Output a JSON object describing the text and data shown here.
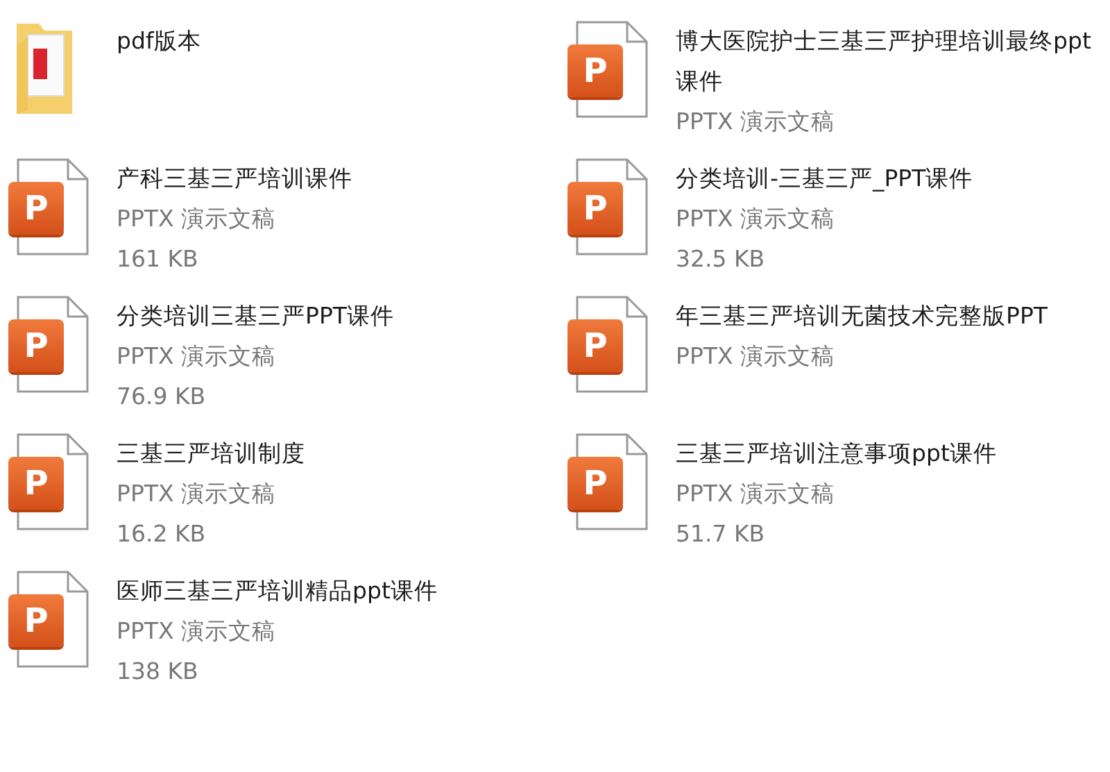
{
  "items": [
    {
      "kind": "folder",
      "name": "pdf版本"
    },
    {
      "kind": "pptx",
      "icon_text": "P",
      "name": "博大医院护士三基三严护理培训最终ppt课件",
      "type": "PPTX 演示文稿"
    },
    {
      "kind": "pptx",
      "icon_text": "P",
      "name": "产科三基三严培训课件",
      "type": "PPTX 演示文稿",
      "size": "161 KB"
    },
    {
      "kind": "pptx",
      "icon_text": "P",
      "name": "分类培训-三基三严_PPT课件",
      "type": "PPTX 演示文稿",
      "size": "32.5 KB"
    },
    {
      "kind": "pptx",
      "icon_text": "P",
      "name": "分类培训三基三严PPT课件",
      "type": "PPTX 演示文稿",
      "size": "76.9 KB"
    },
    {
      "kind": "pptx",
      "icon_text": "P",
      "name": "年三基三严培训无菌技术完整版PPT",
      "type": "PPTX 演示文稿"
    },
    {
      "kind": "pptx",
      "icon_text": "P",
      "name": "三基三严培训制度",
      "type": "PPTX 演示文稿",
      "size": "16.2 KB"
    },
    {
      "kind": "pptx",
      "icon_text": "P",
      "name": "三基三严培训注意事项ppt课件",
      "type": "PPTX 演示文稿",
      "size": "51.7 KB"
    },
    {
      "kind": "pptx",
      "icon_text": "P",
      "name": "医师三基三严培训精品ppt课件",
      "type": "PPTX 演示文稿",
      "size": "138 KB"
    }
  ]
}
